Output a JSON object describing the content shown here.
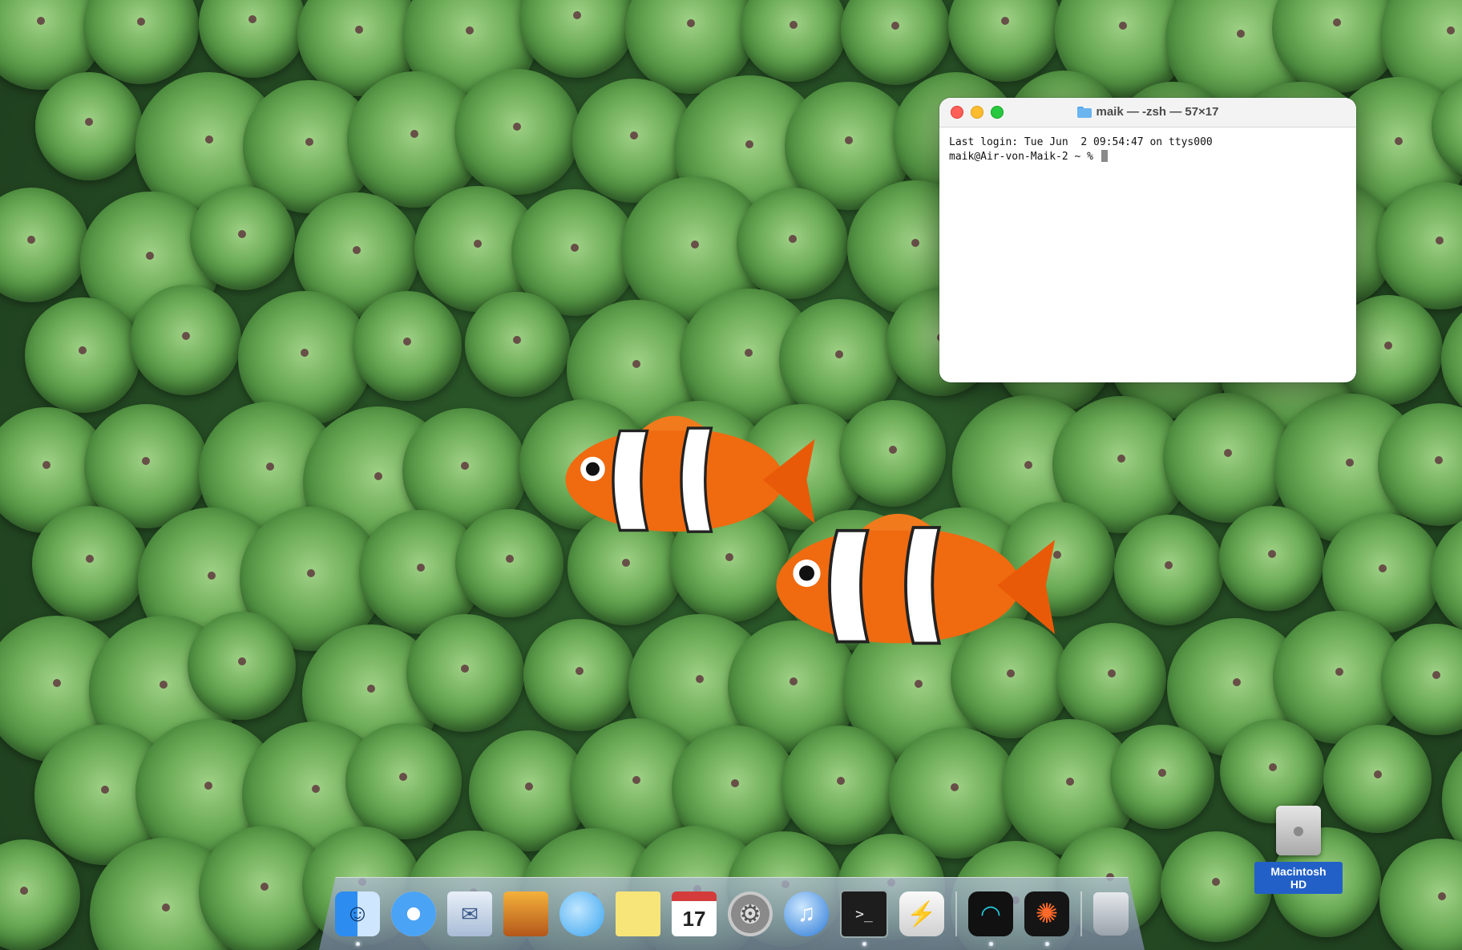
{
  "terminal": {
    "title": "maik — -zsh — 57×17",
    "lines": [
      "Last login: Tue Jun  2 09:54:47 on ttys000",
      "maik@Air-von-Maik-2 ~ % "
    ]
  },
  "dock": {
    "items": [
      {
        "name": "finder",
        "glyph": "☺",
        "running": true
      },
      {
        "name": "safari",
        "glyph": "",
        "running": false
      },
      {
        "name": "mail",
        "glyph": "✉",
        "running": false
      },
      {
        "name": "iphoto",
        "glyph": "",
        "running": false
      },
      {
        "name": "messages",
        "glyph": "",
        "running": false
      },
      {
        "name": "notes",
        "glyph": "",
        "running": false
      },
      {
        "name": "calendar",
        "glyph": "17",
        "running": false
      },
      {
        "name": "system-preferences",
        "glyph": "⚙",
        "running": false
      },
      {
        "name": "itunes",
        "glyph": "♫",
        "running": false
      },
      {
        "name": "terminal",
        "glyph": ">_",
        "running": true
      },
      {
        "name": "reeder",
        "glyph": "⚡",
        "running": false
      },
      {
        "name": "wave-app",
        "glyph": "◠",
        "running": true
      },
      {
        "name": "star-app",
        "glyph": "✺",
        "running": true
      },
      {
        "name": "trash",
        "glyph": "",
        "running": false
      }
    ]
  },
  "desktop": {
    "hd_label": "Macintosh HD"
  }
}
